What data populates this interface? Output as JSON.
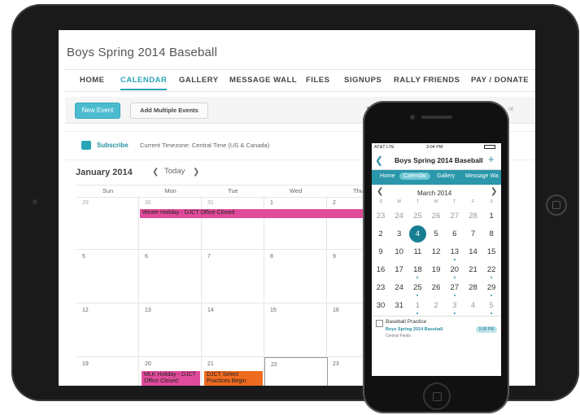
{
  "tablet_app": {
    "team_title": "Boys Spring 2014 Baseball",
    "nav": [
      "HOME",
      "CALENDAR",
      "GALLERY",
      "MESSAGE WALL",
      "FILES",
      "SIGNUPS",
      "RALLY FRIENDS",
      "PAY / DONATE"
    ],
    "active_nav": "CALENDAR",
    "toolbar": {
      "new_event": "New Event",
      "add_multiple": "Add Multiple Events",
      "flag_text": "R",
      "tail_text": "nt"
    },
    "subscribe": "Subscribe",
    "timezone": "Current Timezone: Central Time (US & Canada)",
    "month_label": "January 2014",
    "today_label": "Today",
    "prev_icon": "chevron-left-icon",
    "next_icon": "chevron-right-icon",
    "weekdays": [
      "Sun",
      "Mon",
      "Tue",
      "Wed",
      "Thu"
    ],
    "weeks": [
      [
        "29",
        "30",
        "31",
        "1",
        "2"
      ],
      [
        "5",
        "6",
        "7",
        "8",
        "9"
      ],
      [
        "12",
        "13",
        "14",
        "15",
        "16"
      ],
      [
        "19",
        "20",
        "21",
        "22",
        "23"
      ]
    ],
    "events": {
      "winter_holiday": "Winter Holiday - DJCT Office Closed",
      "mlk_holiday": "MLK Holiday - DJCT Office Closed",
      "select_practices": "DJCT Select Practices Begin"
    },
    "colors": {
      "accent": "#2aa5b9",
      "pink_event": "#e04b9b",
      "orange_event": "#ee6b1f"
    }
  },
  "phone_app": {
    "status": {
      "carrier": "AT&T  LTE",
      "time": "3:04 PM"
    },
    "title": "Boys Spring 2014 Baseball",
    "back_icon": "chevron-left-icon",
    "add_icon": "plus-icon",
    "tabs": [
      "Home",
      "Calendar",
      "Gallery",
      "Message Wa"
    ],
    "active_tab": "Calendar",
    "month_label": "March 2014",
    "weekday_initials": [
      "S",
      "M",
      "T",
      "W",
      "T",
      "F",
      "S"
    ],
    "weeks": [
      [
        "23",
        "24",
        "25",
        "26",
        "27",
        "28",
        "1"
      ],
      [
        "2",
        "3",
        "4",
        "5",
        "6",
        "7",
        "8"
      ],
      [
        "9",
        "10",
        "11",
        "12",
        "13",
        "14",
        "15"
      ],
      [
        "16",
        "17",
        "18",
        "19",
        "20",
        "21",
        "22"
      ],
      [
        "23",
        "24",
        "25",
        "26",
        "27",
        "28",
        "29"
      ],
      [
        "30",
        "31",
        "1",
        "2",
        "3",
        "4",
        "5"
      ]
    ],
    "selected_day": "4",
    "event": {
      "title": "Baseball Practice",
      "team": "Boys Spring 2014 Baseball",
      "location": "Central Fields",
      "time": "5:00 PM"
    }
  }
}
